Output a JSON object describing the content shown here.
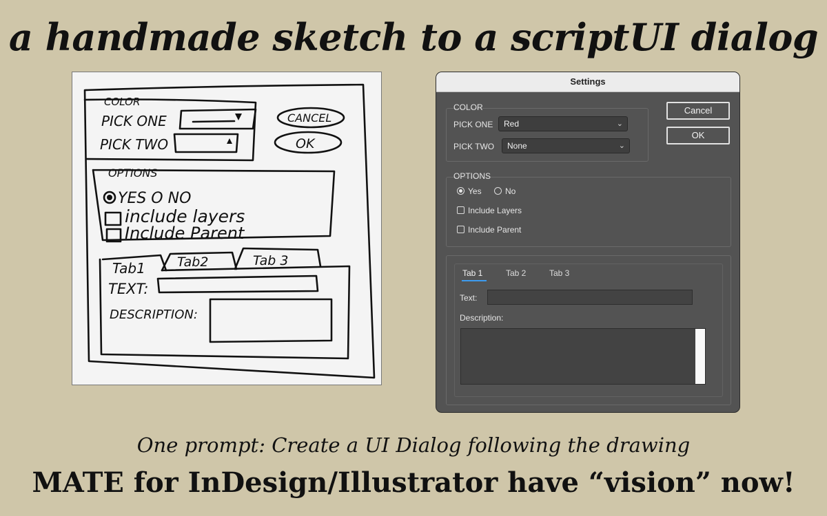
{
  "headline": "a handmade sketch to a scriptUI dialog",
  "sketch": {
    "color_title": "COLOR",
    "pick_one": "PICK ONE",
    "pick_two": "PICK TWO",
    "cancel": "CANCEL",
    "ok": "OK",
    "options_title": "OPTIONS",
    "yes_no": "YES O NO",
    "include_layers": "include layers",
    "include_parent": "Include Parent",
    "tab1": "Tab1",
    "tab2": "Tab2",
    "tab3": "Tab 3",
    "text": "TEXT:",
    "description": "DESCRIPTION:"
  },
  "dialog": {
    "title": "Settings",
    "color_panel": {
      "title": "COLOR",
      "pick_one_label": "PICK ONE",
      "pick_one_value": "Red",
      "pick_two_label": "PICK TWO",
      "pick_two_value": "None"
    },
    "buttons": {
      "cancel": "Cancel",
      "ok": "OK"
    },
    "options_panel": {
      "title": "OPTIONS",
      "yes": "Yes",
      "no": "No",
      "selected": "Yes",
      "include_layers": "Include Layers",
      "include_parent": "Include Parent"
    },
    "tabs": {
      "items": [
        "Tab 1",
        "Tab 2",
        "Tab 3"
      ],
      "active": "Tab 1",
      "text_label": "Text:",
      "description_label": "Description:"
    },
    "icons": {
      "dropdown": "chevron-down-icon",
      "checkbox": "checkbox-unchecked-icon",
      "radio": "radio-icon"
    },
    "accent_color": "#3d9bf0"
  },
  "caption": {
    "subtitle": "One prompt: Create a UI Dialog following the drawing",
    "title": "MATE for InDesign/Illustrator have “vision” now!"
  }
}
